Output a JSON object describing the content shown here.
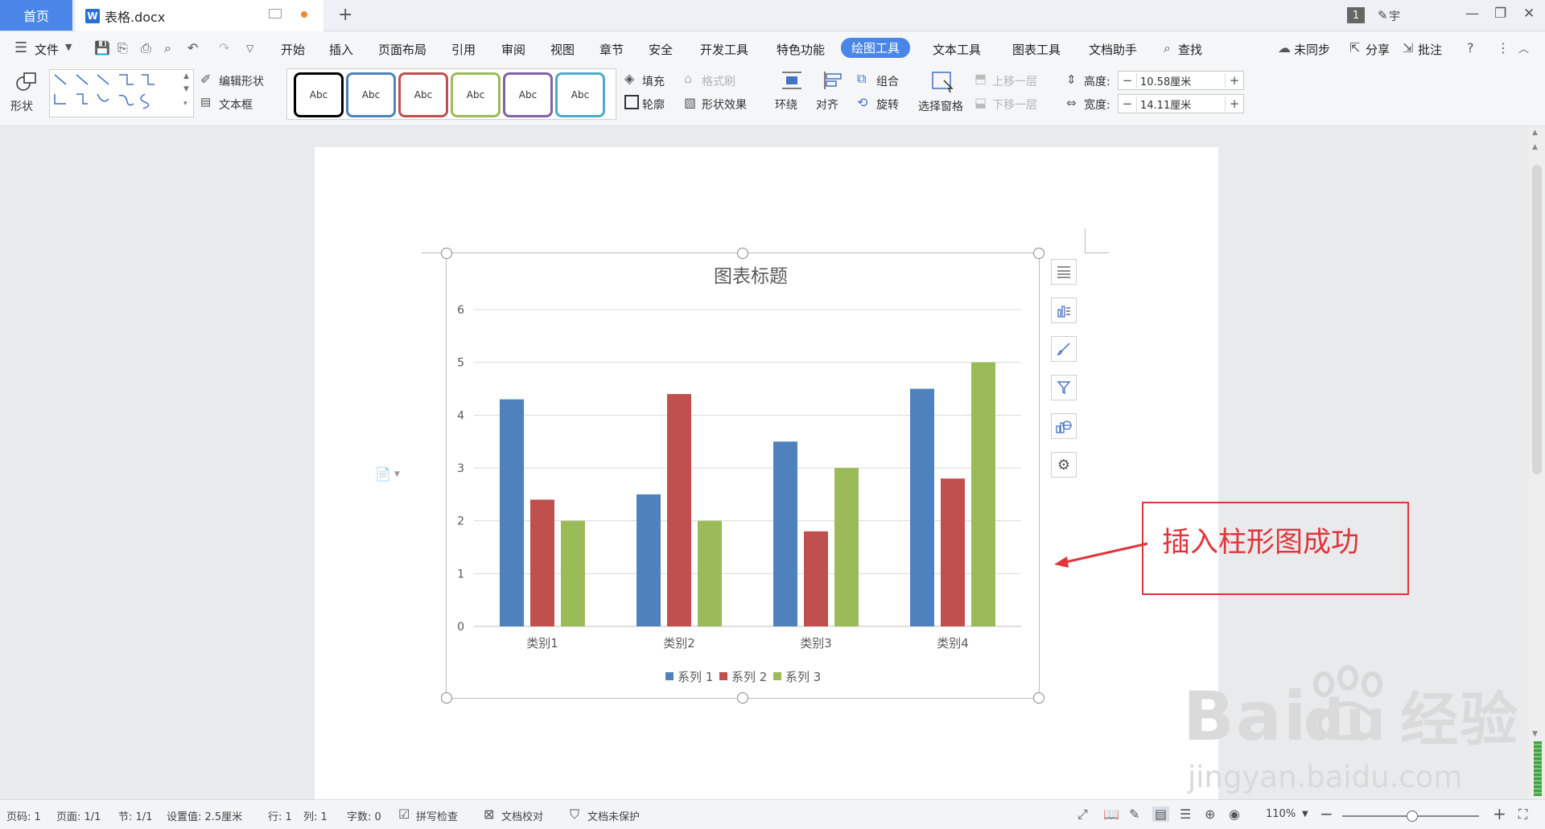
{
  "titlebar": {
    "home_tab": "首页",
    "doc_tab": "表格.docx",
    "doc_icon": "W",
    "new_tab": "+",
    "badge": "1",
    "user": "宇",
    "win_min": "—",
    "win_max": "❐",
    "win_close": "✕"
  },
  "menu": {
    "file": "文件",
    "items": [
      "开始",
      "插入",
      "页面布局",
      "引用",
      "审阅",
      "视图",
      "章节",
      "安全",
      "开发工具",
      "特色功能",
      "绘图工具",
      "文本工具",
      "图表工具",
      "文档助手"
    ],
    "active": "绘图工具",
    "search": "查找",
    "sync": "未同步",
    "share": "分享",
    "comment": "批注"
  },
  "toolbar": {
    "shape": "形状",
    "edit_shape": "编辑形状",
    "textbox": "文本框",
    "style_label": "Abc",
    "style_colors": [
      "#000000",
      "#4f81bd",
      "#c0504d",
      "#9bbb59",
      "#8064a2",
      "#4bacc6"
    ],
    "fill": "填充",
    "format_painter": "格式刷",
    "outline": "轮廓",
    "shape_effect": "形状效果",
    "wrap": "环绕",
    "align": "对齐",
    "group": "组合",
    "rotate": "旋转",
    "select_pane": "选择窗格",
    "bring_forward": "上移一层",
    "send_backward": "下移一层",
    "height_label": "高度:",
    "height_value": "10.58厘米",
    "width_label": "宽度:",
    "width_value": "14.11厘米"
  },
  "chart_data": {
    "type": "bar",
    "title": "图表标题",
    "categories": [
      "类别1",
      "类别2",
      "类别3",
      "类别4"
    ],
    "series": [
      {
        "name": "系列 1",
        "color": "#4f81bd",
        "values": [
          4.3,
          2.5,
          3.5,
          4.5
        ]
      },
      {
        "name": "系列 2",
        "color": "#c0504d",
        "values": [
          2.4,
          4.4,
          1.8,
          2.8
        ]
      },
      {
        "name": "系列 3",
        "color": "#9bbb59",
        "values": [
          2.0,
          2.0,
          3.0,
          5.0
        ]
      }
    ],
    "ylim": [
      0,
      6
    ],
    "yticks": [
      0,
      1,
      2,
      3,
      4,
      5,
      6
    ],
    "grid": true,
    "legend": "bottom"
  },
  "annotation": {
    "callout": "插入柱形图成功",
    "color": "#e0353a"
  },
  "watermark": {
    "logo": "Bai du 经验",
    "url": "jingyan.baidu.com"
  },
  "statusbar": {
    "page_num": "页码: 1",
    "pages": "页面: 1/1",
    "section": "节: 1/1",
    "setting": "设置值: 2.5厘米",
    "row": "行: 1",
    "col": "列: 1",
    "words": "字数: 0",
    "spell": "拼写检查",
    "proof": "文档校对",
    "protect": "文档未保护",
    "zoom": "110%"
  }
}
